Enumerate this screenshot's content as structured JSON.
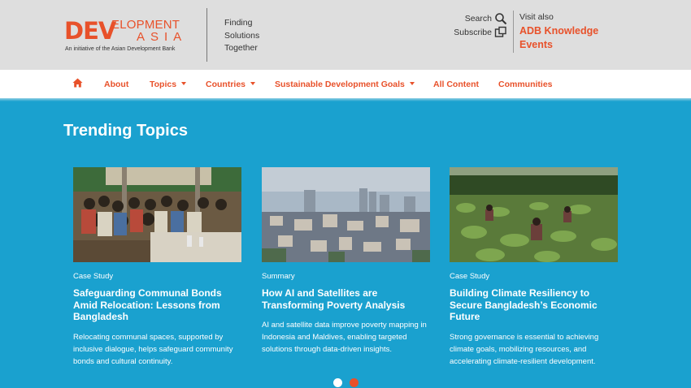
{
  "brand": {
    "logo_dev": "DEV",
    "logo_elopment": "ELOPMENT",
    "logo_asia": "ASIA",
    "logo_sub": "An initiative of the Asian Development Bank",
    "tagline": [
      "Finding",
      "Solutions",
      "Together"
    ]
  },
  "utility": {
    "search_label": "Search",
    "subscribe_label": "Subscribe",
    "visit_label": "Visit also",
    "adb_link_line1": "ADB Knowledge",
    "adb_link_line2": "Events"
  },
  "nav": {
    "items": [
      {
        "label": "About",
        "dropdown": false
      },
      {
        "label": "Topics",
        "dropdown": true
      },
      {
        "label": "Countries",
        "dropdown": true
      },
      {
        "label": "Sustainable Development Goals",
        "dropdown": true
      },
      {
        "label": "All Content",
        "dropdown": false
      },
      {
        "label": "Communities",
        "dropdown": false
      }
    ]
  },
  "main": {
    "section_title": "Trending Topics",
    "cards": [
      {
        "type": "Case Study",
        "title": "Safeguarding Communal Bonds Amid Relocation: Lessons from Bangladesh",
        "desc": "Relocating communal spaces, supported by inclusive dialogue, helps safeguard community bonds and cultural continuity."
      },
      {
        "type": "Summary",
        "title": "How AI and Satellites are Transforming Poverty Analysis",
        "desc": "AI and satellite data improve poverty mapping in Indonesia and Maldives, enabling targeted solutions through data-driven insights."
      },
      {
        "type": "Case Study",
        "title": "Building Climate Resiliency to Secure Bangladesh’s Economic Future",
        "desc": "Strong governance is essential to achieving climate goals, mobilizing resources, and accelerating climate-resilient development."
      }
    ],
    "carousel": {
      "active_index": 1,
      "total": 2
    }
  },
  "colors": {
    "brand_orange": "#e8512a",
    "background_blue": "#1aa1cf",
    "header_gray": "#dedede"
  }
}
